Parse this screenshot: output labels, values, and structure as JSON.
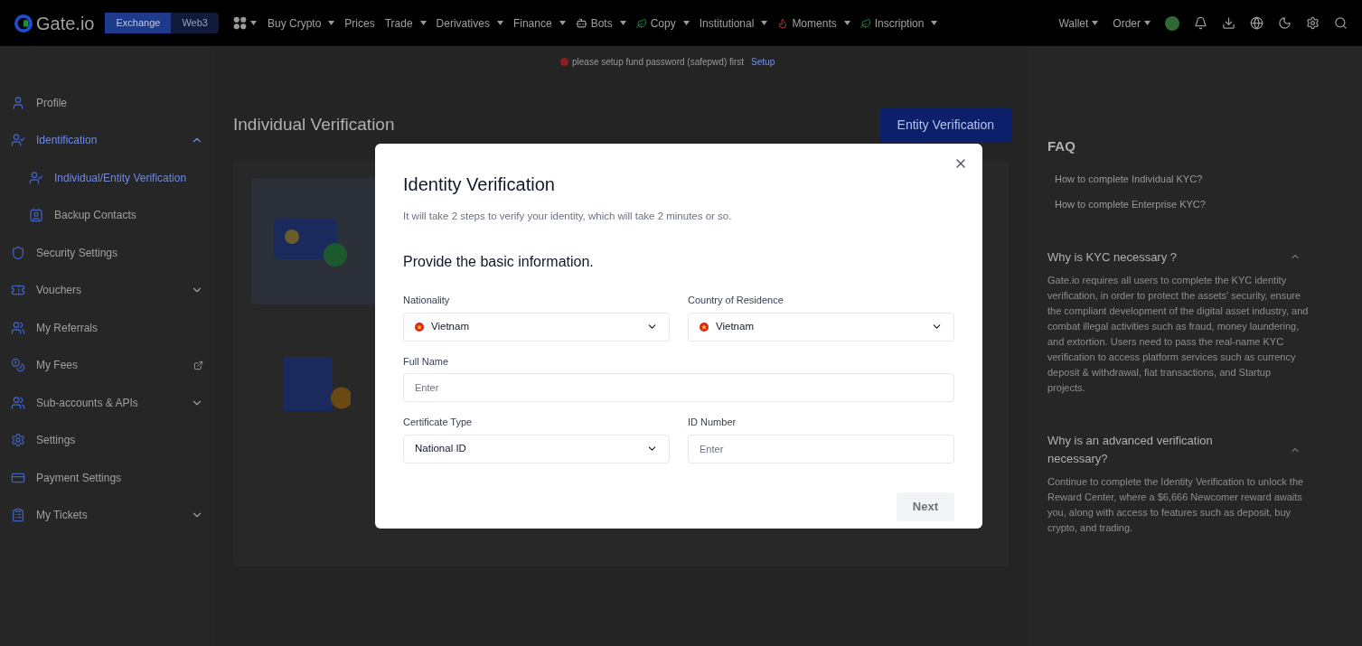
{
  "header": {
    "logo": "Gate.io",
    "modes": [
      {
        "label": "Exchange",
        "selected": true
      },
      {
        "label": "Web3",
        "selected": false
      }
    ],
    "nav": [
      {
        "label": "Buy Crypto",
        "has_menu": true
      },
      {
        "label": "Prices",
        "has_menu": false
      },
      {
        "label": "Trade",
        "has_menu": true
      },
      {
        "label": "Derivatives",
        "has_menu": true
      },
      {
        "label": "Finance",
        "has_menu": true
      },
      {
        "label": "Bots",
        "has_menu": true
      },
      {
        "label": "Copy",
        "has_menu": true
      },
      {
        "label": "Institutional",
        "has_menu": true
      },
      {
        "label": "Moments",
        "has_menu": true
      },
      {
        "label": "Inscription",
        "has_menu": true
      }
    ],
    "right": [
      {
        "label": "Wallet"
      },
      {
        "label": "Order"
      }
    ]
  },
  "notice": {
    "text": "please setup fund password (safepwd) first",
    "link": "Setup"
  },
  "sidebar": {
    "items": [
      {
        "label": "Profile",
        "external": false,
        "selected": false
      },
      {
        "label": "Identification",
        "expanded": true,
        "external": false,
        "selected": true,
        "children": [
          {
            "label": "Individual/Entity Verification",
            "selected": true
          },
          {
            "label": "Backup Contacts",
            "selected": false
          }
        ]
      },
      {
        "label": "Security Settings",
        "external": false,
        "selected": false
      },
      {
        "label": "Vouchers",
        "expanded": false,
        "external": false,
        "selected": false
      },
      {
        "label": "My Referrals",
        "external": false,
        "selected": false
      },
      {
        "label": "My Fees",
        "external": true,
        "selected": false
      },
      {
        "label": "Sub-accounts & APIs",
        "expanded": false,
        "external": false,
        "selected": false
      },
      {
        "label": "Settings",
        "external": false,
        "selected": false
      },
      {
        "label": "Payment Settings",
        "external": false,
        "selected": false
      },
      {
        "label": "My Tickets",
        "expanded": false,
        "external": false,
        "selected": false
      }
    ]
  },
  "main": {
    "title": "Individual Verification",
    "entity_button": "Entity Verification"
  },
  "faq": {
    "title": "FAQ",
    "links": [
      "How to complete Individual KYC?",
      "How to complete Enterprise KYC?"
    ],
    "sections": [
      {
        "question": "Why is KYC necessary ?",
        "expanded": true,
        "answer": "Gate.io requires all users to complete the KYC identity verification, in order to protect the assets' security, ensure the compliant development of the digital asset industry, and combat illegal activities such as fraud, money laundering, and extortion. Users need to pass the real-name KYC verification to access platform services such as currency deposit & withdrawal, fiat transactions, and Startup projects."
      },
      {
        "question": "Why is an advanced verification necessary?",
        "expanded": true,
        "answer": "Continue to complete the Identity Verification to unlock the Reward Center, where a $6,666 Newcomer reward awaits you, along with access to features such as deposit, buy crypto, and trading."
      }
    ]
  },
  "modal": {
    "title": "Identity Verification",
    "subtitle": "It will take 2 steps to verify your identity, which will take 2 minutes or so.",
    "section": "Provide the basic information.",
    "fields": [
      {
        "label": "Nationality",
        "kind": "country",
        "value": "Vietnam"
      },
      {
        "label": "Country of Residence",
        "kind": "country",
        "value": "Vietnam"
      },
      {
        "label": "Full Name",
        "kind": "text",
        "placeholder": "Enter"
      },
      {
        "label": "Certificate Type",
        "kind": "select",
        "value": "National ID"
      },
      {
        "label": "ID Number",
        "kind": "text",
        "placeholder": "Enter"
      }
    ],
    "next_button": {
      "label": "Next",
      "disabled": true
    }
  }
}
